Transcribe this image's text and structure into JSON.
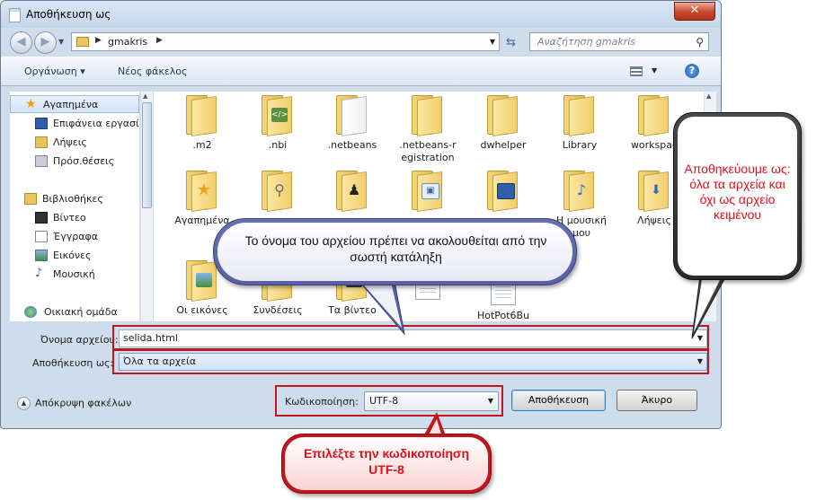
{
  "window": {
    "title": "Αποθήκευση ως",
    "close_glyph": "✕"
  },
  "address": {
    "path": "gmakris",
    "search_placeholder": "Αναζήτηση gmakris"
  },
  "toolbar": {
    "organize": "Οργάνωση ▾",
    "new_folder": "Νέος φάκελος",
    "help": "?"
  },
  "nav": {
    "items": [
      {
        "label": "Αγαπημένα",
        "icon": "star-icon"
      },
      {
        "label": "Επιφάνεια εργασίας",
        "icon": "desktop-icon"
      },
      {
        "label": "Λήψεις",
        "icon": "downloads-icon"
      },
      {
        "label": "Πρόσ.θέσεις",
        "icon": "recent-places-icon"
      },
      {
        "label": "Βιβλιοθήκες",
        "icon": "libraries-icon"
      },
      {
        "label": "Βίντεο",
        "icon": "video-icon"
      },
      {
        "label": "Έγγραφα",
        "icon": "documents-icon"
      },
      {
        "label": "Εικόνες",
        "icon": "pictures-icon"
      },
      {
        "label": "Μουσική",
        "icon": "music-icon"
      },
      {
        "label": "Οικιακή ομάδα",
        "icon": "homegroup-icon"
      }
    ]
  },
  "files": {
    "row1": [
      {
        "label": ".m2",
        "icon": "folder-icon"
      },
      {
        "label": ".nbi",
        "icon": "folder-icon"
      },
      {
        "label": ".netbeans",
        "icon": "folder-icon"
      },
      {
        "label": ".netbeans-r egistration",
        "icon": "folder-icon"
      },
      {
        "label": "dwhelper",
        "icon": "folder-icon"
      },
      {
        "label": "Library",
        "icon": "folder-icon"
      },
      {
        "label": "workspac",
        "icon": "folder-icon"
      }
    ],
    "row2": [
      {
        "label": "Αγαπημένα",
        "icon": "favorites-folder-icon"
      },
      {
        "label": "",
        "icon": "search-folder-icon"
      },
      {
        "label": "",
        "icon": "games-folder-icon"
      },
      {
        "label": "",
        "icon": "contacts-folder-icon"
      },
      {
        "label": "",
        "icon": "desktop-folder-icon"
      },
      {
        "label": "Η μουσική μου",
        "icon": "music-folder-icon"
      },
      {
        "label": "Λήψεις",
        "icon": "downloads-folder-icon"
      }
    ],
    "row3": [
      {
        "label": "Οι εικόνες",
        "icon": "pictures-folder-icon"
      },
      {
        "label": "Συνδέσεις",
        "icon": "links-folder-icon"
      },
      {
        "label": "Τα βίντεο",
        "icon": "videos-folder-icon"
      },
      {
        "label": "",
        "icon": "file-icon"
      },
      {
        "label": "HotPot6Bu",
        "icon": "document-icon"
      }
    ]
  },
  "form": {
    "filename_label": "Όνομα αρχείου:",
    "filename_value": "selida.html",
    "savetype_label": "Αποθήκευση ως:",
    "savetype_value": "Όλα τα αρχεία",
    "hide_folders": "Απόκρυψη φακέλων",
    "encoding_label": "Κωδικοποίηση:",
    "encoding_value": "UTF-8",
    "save_button": "Αποθήκευση",
    "cancel_button": "Άκυρο"
  },
  "callouts": {
    "extension": "Το όνομα του αρχείου  πρέπει να ακολουθείται από την σωστή κατάληξη",
    "savetype": "Αποθηκεύουμε ως: όλα τα αρχεία και όχι ως αρχείο κειμένου",
    "encoding": "Επιλέξτε την κωδικοποίηση UTF-8"
  },
  "colors": {
    "highlight": "#c3161c",
    "callout_text_red": "#e0101a",
    "callout_bubble": "#5a5fa6"
  }
}
